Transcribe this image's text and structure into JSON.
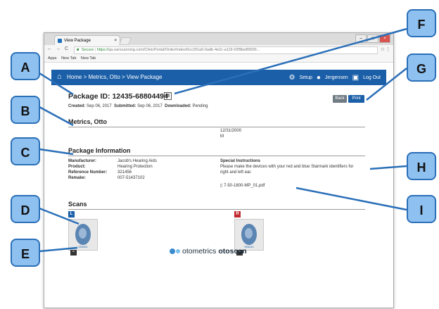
{
  "browser": {
    "tab_title": "View Package",
    "tab_close": "×",
    "window_buttons": [
      "–",
      "□",
      "×"
    ],
    "nav_back": "←",
    "nav_forward": "→",
    "nav_reload": "C",
    "secure_label": "Secure",
    "url_protocol": "https://",
    "url_rest": "qa.earscanning.com/ClinicPortal/Order/Index/0cc291a0-0adb-4e2c-a119-02f9be85600...",
    "star": "☆",
    "menu": "⋮",
    "bookmarks": [
      "Apps",
      "New Tab",
      "New Tab"
    ]
  },
  "appbar": {
    "breadcrumb": "Home > Metrics, Otto > View Package",
    "setup_label": "Setup",
    "user_label": "Jergensen",
    "logout_label": "Log Out"
  },
  "package": {
    "title": "Package ID: 12435-68804494",
    "created_label": "Created:",
    "created_value": "Sep 06, 2017",
    "submitted_label": "Submitted:",
    "submitted_value": "Sep 06, 2017",
    "downloaded_label": "Downloaded:",
    "downloaded_value": "Pending",
    "back_button": "Back",
    "print_button": "Print"
  },
  "patient": {
    "name": "Metrics, Otto",
    "dob": "12/31/2000",
    "gender": "M"
  },
  "package_info": {
    "heading": "Package Information",
    "manufacturer_label": "Manufacturer:",
    "manufacturer_value": "Jacob's Hearing Aids",
    "product_label": "Product:",
    "product_value": "Hearing Protection",
    "reference_label": "Reference Number:",
    "reference_value": "321456",
    "remake_label": "Remake:",
    "remake_value": "007-51437102",
    "special_label": "Special Instructions",
    "special_text": "Please make the devices with your red and blue Starmark identifiers for right and left ear.",
    "attachment": "7-50-1800-MP_01.pdf"
  },
  "scans": {
    "heading": "Scans",
    "left_label": "L",
    "right_label": "R",
    "left_caption": "093401",
    "right_caption": "093410"
  },
  "logo": {
    "brand": "otometrics",
    "product": "otoscan"
  },
  "callouts": [
    "A",
    "B",
    "C",
    "D",
    "E",
    "F",
    "G",
    "H",
    "I"
  ],
  "colors": {
    "appbar": "#1b5fa8",
    "callout_fill": "#8fc1f0",
    "callout_border": "#2a6fb8",
    "left_badge": "#1b5fa8",
    "right_badge": "#c0282d"
  }
}
